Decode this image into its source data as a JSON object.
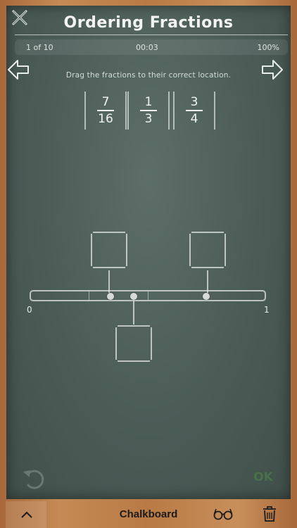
{
  "header": {
    "title": "Ordering Fractions"
  },
  "status": {
    "progress_text": "1 of 10",
    "timer": "00:03",
    "score": "100%"
  },
  "instruction": "Drag the fractions to their correct location.",
  "fractions": [
    {
      "numerator": "7",
      "denominator": "16"
    },
    {
      "numerator": "1",
      "denominator": "3"
    },
    {
      "numerator": "3",
      "denominator": "4"
    }
  ],
  "number_line": {
    "start_label": "0",
    "end_label": "1",
    "marker_values": [
      0.34,
      0.44,
      0.75
    ]
  },
  "controls": {
    "ok_label": "OK"
  },
  "footer": {
    "label": "Chalkboard"
  },
  "icons": [
    "close-icon",
    "back-arrow-icon",
    "forward-arrow-icon",
    "undo-icon",
    "chevron-up-icon",
    "glasses-icon",
    "trash-icon"
  ]
}
